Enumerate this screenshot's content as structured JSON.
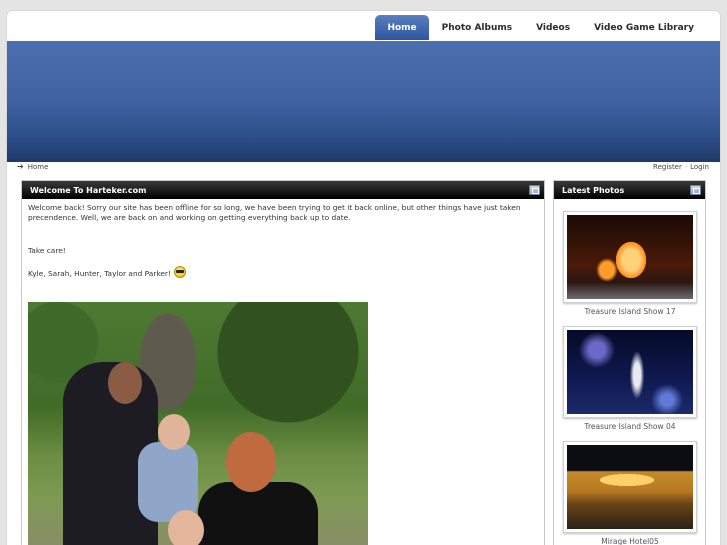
{
  "nav": {
    "tabs": [
      {
        "label": "Home",
        "active": true
      },
      {
        "label": "Photo Albums",
        "active": false
      },
      {
        "label": "Videos",
        "active": false
      },
      {
        "label": "Video Game Library",
        "active": false
      }
    ]
  },
  "breadcrumb": {
    "label": "Home"
  },
  "account": {
    "register": "Register",
    "separator": "·",
    "login": "Login"
  },
  "welcome": {
    "title": "Welcome To Harteker.com",
    "para1": "Welcome back!  Sorry our site has been offline for so long, we have been trying to get it back online, but other things have just taken precendence.  Well, we are back on and working on getting everything back up to date.",
    "para2": "Take care!",
    "para3": "Kyle, Sarah, Hunter, Taylor and Parker!"
  },
  "latest": {
    "title": "Latest Photos",
    "photos": [
      {
        "caption": "Treasure Island Show 17"
      },
      {
        "caption": "Treasure Island Show 04"
      },
      {
        "caption": "Mirage Hotel05"
      }
    ]
  },
  "colors": {
    "tab_active": "#3f62a2",
    "banner": "#3f62a2",
    "panel_header": "#000000"
  },
  "icons": [
    "arrow-right-icon",
    "panel-options-icon",
    "sunglasses-smiley-icon"
  ]
}
